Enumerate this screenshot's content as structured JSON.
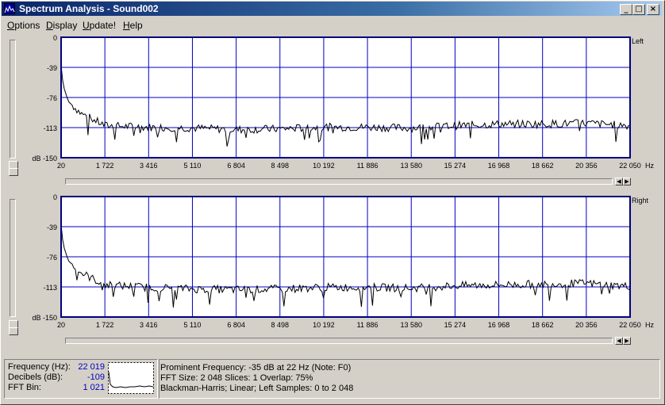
{
  "window": {
    "title": "Spectrum Analysis - Sound002"
  },
  "title_buttons": {
    "minimize": "_",
    "maximize": "□",
    "close": "×"
  },
  "menu": [
    {
      "label": "Options",
      "underline": "O"
    },
    {
      "label": "Display",
      "underline": "D"
    },
    {
      "label": "Update!",
      "underline": "U"
    },
    {
      "label": "Help",
      "underline": "H"
    }
  ],
  "charts": {
    "top": {
      "channel": "Left"
    },
    "bottom": {
      "channel": "Right"
    },
    "y_ticks": [
      "0",
      "-39",
      "-76",
      "-113",
      "dB -150"
    ],
    "x_ticks": [
      "20",
      "1 722",
      "3 416",
      "5 110",
      "6 804",
      "8 498",
      "10 192",
      "11 886",
      "13 580",
      "15 274",
      "16 968",
      "18 662",
      "20 356",
      "22 050"
    ],
    "x_unit": "Hz"
  },
  "chart_data": [
    {
      "type": "line",
      "title": "Left",
      "xlabel": "Hz",
      "ylabel": "dB",
      "xlim": [
        20,
        22050
      ],
      "ylim": [
        -150,
        0
      ],
      "grid": true,
      "series": [
        {
          "name": "Left",
          "x": [
            20,
            100,
            300,
            800,
            1722,
            3416,
            5110,
            6804,
            8498,
            10192,
            11886,
            13580,
            15274,
            16968,
            18662,
            20356,
            22050
          ],
          "values": [
            -35,
            -60,
            -80,
            -95,
            -110,
            -112,
            -113,
            -115,
            -114,
            -112,
            -112,
            -113,
            -110,
            -108,
            -108,
            -107,
            -110
          ]
        }
      ]
    },
    {
      "type": "line",
      "title": "Right",
      "xlabel": "Hz",
      "ylabel": "dB",
      "xlim": [
        20,
        22050
      ],
      "ylim": [
        -150,
        0
      ],
      "grid": true,
      "series": [
        {
          "name": "Right",
          "x": [
            20,
            100,
            300,
            800,
            1722,
            3416,
            5110,
            6804,
            8498,
            10192,
            11886,
            13580,
            15274,
            16968,
            18662,
            20356,
            22050
          ],
          "values": [
            -35,
            -60,
            -80,
            -95,
            -110,
            -113,
            -115,
            -116,
            -115,
            -113,
            -113,
            -114,
            -111,
            -110,
            -109,
            -108,
            -112
          ]
        }
      ]
    }
  ],
  "status": {
    "frequency_label": "Frequency (Hz):",
    "frequency_value": "22 019",
    "decibels_label": "Decibels (dB):",
    "decibels_value": "-109",
    "bin_label": "FFT Bin:",
    "bin_value": "1 021",
    "line1": "Prominent Frequency: -35 dB at 22 Hz (Note: F0)",
    "line2": "FFT Size: 2 048  Slices: 1  Overlap: 75%",
    "line3": "Blackman-Harris; Linear; Left  Samples: 0 to 2 048"
  },
  "colors": {
    "grid": "#0000c0",
    "trace": "#000000",
    "plot_bg": "#ffffff",
    "frame": "#000080"
  }
}
